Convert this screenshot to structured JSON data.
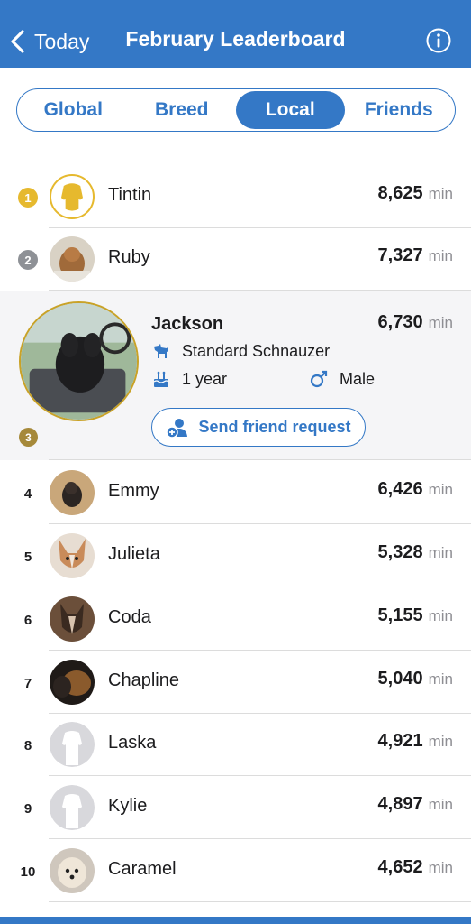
{
  "header": {
    "back_label": "Today",
    "title": "February Leaderboard"
  },
  "tabs": [
    {
      "label": "Global",
      "active": false
    },
    {
      "label": "Breed",
      "active": false
    },
    {
      "label": "Local",
      "active": true
    },
    {
      "label": "Friends",
      "active": false
    }
  ],
  "unit": "min",
  "leaders": [
    {
      "rank": "1",
      "name": "Tintin",
      "score": "8,625"
    },
    {
      "rank": "2",
      "name": "Ruby",
      "score": "7,327"
    }
  ],
  "featured": {
    "rank": "3",
    "name": "Jackson",
    "score": "6,730",
    "breed": "Standard Schnauzer",
    "age": "1 year",
    "sex": "Male",
    "friend_button": "Send friend request"
  },
  "others": [
    {
      "rank": "4",
      "name": "Emmy",
      "score": "6,426"
    },
    {
      "rank": "5",
      "name": "Julieta",
      "score": "5,328"
    },
    {
      "rank": "6",
      "name": "Coda",
      "score": "5,155"
    },
    {
      "rank": "7",
      "name": "Chapline",
      "score": "5,040"
    },
    {
      "rank": "8",
      "name": "Laska",
      "score": "4,921"
    },
    {
      "rank": "9",
      "name": "Kylie",
      "score": "4,897"
    },
    {
      "rank": "10",
      "name": "Caramel",
      "score": "4,652"
    }
  ],
  "colors": {
    "accent": "#3478c6",
    "gold": "#e6b92e",
    "silver": "#8e9196",
    "bronze": "#a6893a"
  }
}
